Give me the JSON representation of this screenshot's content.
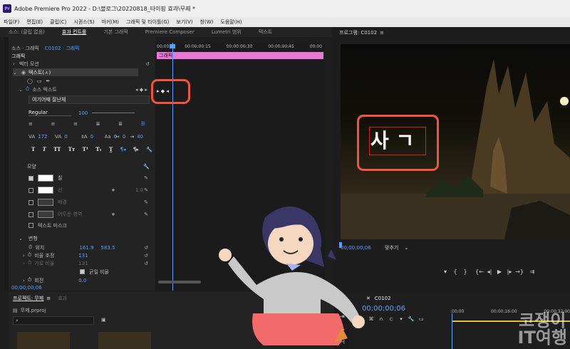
{
  "window": {
    "app_logo": "Pr",
    "title": "Adobe Premiere Pro 2022 - D:\\블로그\\20220818_타이핑 효과\\무제 *"
  },
  "menu": [
    "파일(F)",
    "편집(E)",
    "클립(C)",
    "시퀀스(S)",
    "마커(M)",
    "그래픽 및 타이틀(G)",
    "보기(V)",
    "창(W)",
    "도움말(H)"
  ],
  "panel_tabs": [
    "소스: (클립 없음)",
    "효과 컨트롤",
    "기본 그래픽",
    "Premiere Composer",
    "Lumetri 범위",
    "텍스트"
  ],
  "effect_controls": {
    "breadcrumb_source": "소스 · 그래픽",
    "breadcrumb_clip": "C0102 · 그래픽",
    "ruler_times": [
      "00:00",
      "00:00:00:15",
      "00:00:00:30",
      "00:00:00:45",
      "00:00"
    ],
    "clip_bar_label": "그래픽",
    "section_graphic": "그래픽",
    "vector_motion": "벡터 모션",
    "text_layer": "텍스트(ㅅ)",
    "source_text": "소스 텍스트",
    "font_name": "여기어때 잘난체",
    "font_style": "Regular",
    "font_size": "100",
    "tracking": "172",
    "kerning": "0",
    "leading": "0",
    "baseline": "0",
    "tsume": "0",
    "tab_width": "40",
    "appearance": "모양",
    "fill": "칠",
    "stroke": "선",
    "stroke_width": "1.0",
    "background": "배경",
    "shadow": "어두운 영역",
    "text_mask": "텍스트 마스크",
    "transform": "변형",
    "position": "위치",
    "position_x": "161.9",
    "position_y": "583.5",
    "scale": "비율 조정",
    "scale_value": "131",
    "scale_w": "가로 비율",
    "scale_w_value": "131",
    "uniform": "균일 비율",
    "rotation": "회전",
    "rotation_value": "0.0",
    "timecode": "00;00;00;06"
  },
  "program_monitor": {
    "title": "프로그램: C0102",
    "overlay_text": "사 ㄱ",
    "timecode": "00;00;00;06",
    "fit": "맞추기"
  },
  "project": {
    "tab": "프로젝트: 무제",
    "tab2": "효과",
    "file": "무제.prproj",
    "search_placeholder": ""
  },
  "timeline": {
    "sequence": "C0102",
    "timecode": "00;00;00;06",
    "ruler": [
      ":00:00",
      "00:00:16:00",
      "00:00:32:00"
    ]
  },
  "watermark": {
    "line1": "코쟁이",
    "line2": "IT여행"
  },
  "colors": {
    "highlight_red": "#f0563a",
    "accent_blue": "#4fa3ff",
    "clip_pink": "#e878d8",
    "background_green": "#6fd3a0"
  }
}
